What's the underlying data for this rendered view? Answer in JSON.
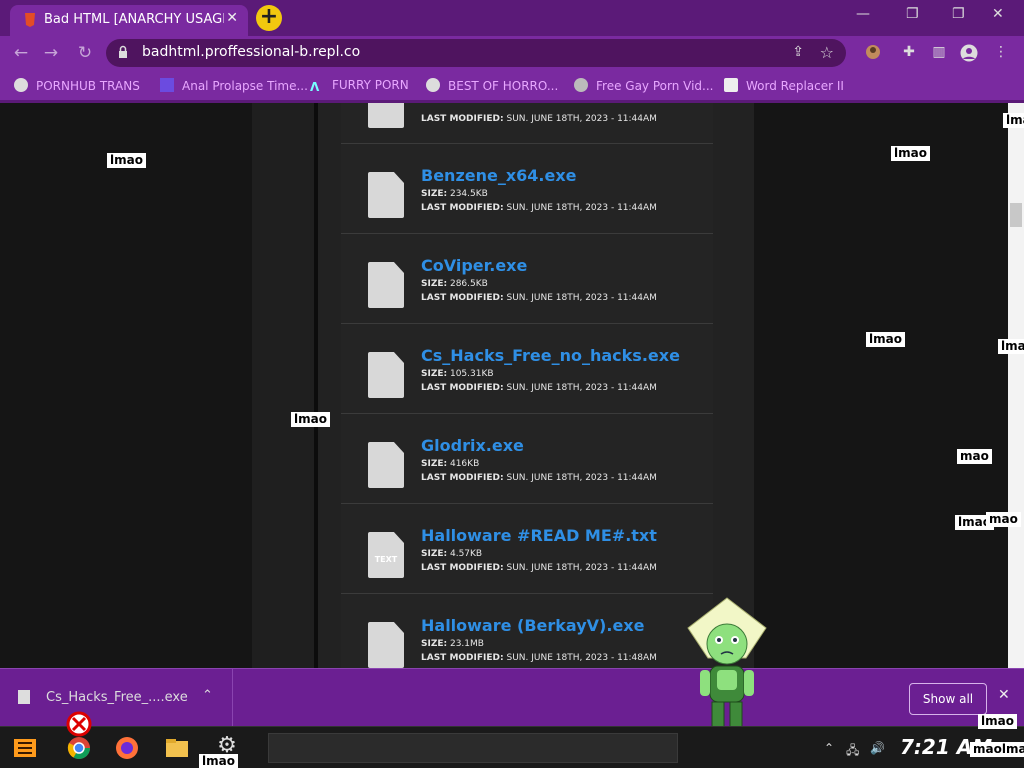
{
  "browser": {
    "tab_title": "Bad HTML [ANARCHY USAGE",
    "tab_close": "✕",
    "new_tab": "+",
    "url": "badhtml.proffessional-b.repl.co",
    "window": {
      "minimize": "—",
      "restore": "❐",
      "close": "✕"
    },
    "bookmarks": [
      {
        "label": "PORNHUB TRANS"
      },
      {
        "label": "Anal Prolapse Time..."
      },
      {
        "label": "FURRY PORN"
      },
      {
        "label": "BEST OF HORRO..."
      },
      {
        "label": "Free Gay Porn Vid..."
      },
      {
        "label": "Word Replacer II"
      }
    ]
  },
  "files": {
    "size_label": "SIZE:",
    "modified_label": "LAST MODIFIED:",
    "top_partial_modified": "SUN. JUNE 18TH, 2023 - 11:44AM",
    "items": [
      {
        "name": "Benzene_x64.exe",
        "size": "234.5KB",
        "modified": "SUN. JUNE 18TH, 2023 - 11:44AM",
        "icon": "file-icon"
      },
      {
        "name": "CoViper.exe",
        "size": "286.5KB",
        "modified": "SUN. JUNE 18TH, 2023 - 11:44AM",
        "icon": "file-icon"
      },
      {
        "name": "Cs_Hacks_Free_no_hacks.exe",
        "size": "105.31KB",
        "modified": "SUN. JUNE 18TH, 2023 - 11:44AM",
        "icon": "file-icon"
      },
      {
        "name": "Glodrix.exe",
        "size": "416KB",
        "modified": "SUN. JUNE 18TH, 2023 - 11:44AM",
        "icon": "file-icon"
      },
      {
        "name": "Halloware #READ ME#.txt",
        "size": "4.57KB",
        "modified": "SUN. JUNE 18TH, 2023 - 11:44AM",
        "icon": "text-file-icon",
        "icon_text": "TEXT"
      },
      {
        "name": "Halloware (BerkayV).exe",
        "size": "23.1MB",
        "modified": "SUN. JUNE 18TH, 2023 - 11:48AM",
        "icon": "file-icon"
      }
    ]
  },
  "overlays": {
    "lmao_word": "lmao",
    "mao_word": "mao",
    "lma_word": "lma",
    "maolmao_word": "maolmao"
  },
  "downloads": {
    "file_name": "Cs_Hacks_Free_....exe",
    "show_all": "Show all",
    "close": "✕"
  },
  "taskbar": {
    "time": "7:21 AM"
  },
  "colors": {
    "chrome_purple": "#7a2aa0",
    "link_blue": "#2f8fe5"
  }
}
